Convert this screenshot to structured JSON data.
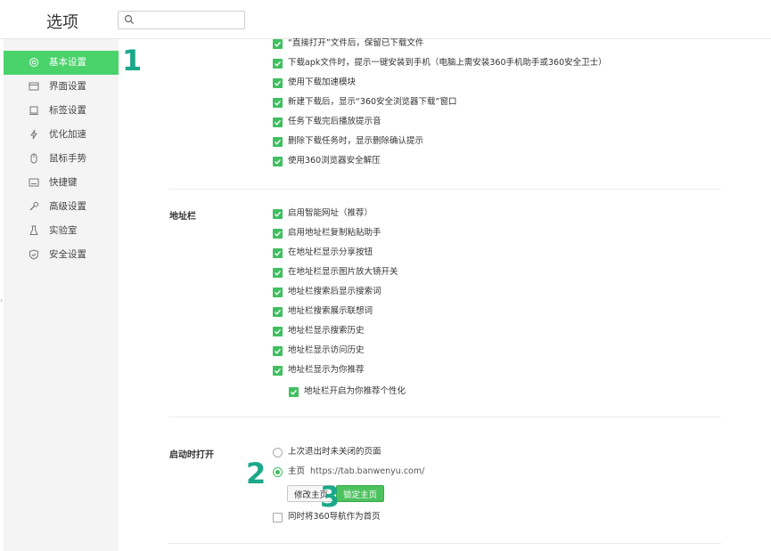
{
  "header": {
    "title": "选项",
    "search": {
      "value": "",
      "placeholder": ""
    }
  },
  "sidebar": {
    "items": [
      {
        "label": "基本设置",
        "icon": "gear-icon",
        "active": true
      },
      {
        "label": "界面设置",
        "icon": "window-icon",
        "active": false
      },
      {
        "label": "标签设置",
        "icon": "tab-icon",
        "active": false
      },
      {
        "label": "优化加速",
        "icon": "lightning-icon",
        "active": false
      },
      {
        "label": "鼠标手势",
        "icon": "mouse-icon",
        "active": false
      },
      {
        "label": "快捷键",
        "icon": "keyboard-icon",
        "active": false
      },
      {
        "label": "高级设置",
        "icon": "wrench-icon",
        "active": false
      },
      {
        "label": "实验室",
        "icon": "flask-icon",
        "active": false
      },
      {
        "label": "安全设置",
        "icon": "shield-icon",
        "active": false
      }
    ]
  },
  "download": {
    "options": [
      {
        "label": "“直接打开”文件后，保留已下载文件",
        "checked": true
      },
      {
        "label": "下载apk文件时，提示一键安装到手机（电脑上需安装360手机助手或360安全卫士）",
        "checked": true
      },
      {
        "label": "使用下载加速模块",
        "checked": true
      },
      {
        "label": "新建下载后，显示“360安全浏览器下载”窗口",
        "checked": true
      },
      {
        "label": "任务下载完后播放提示音",
        "checked": true
      },
      {
        "label": "删除下载任务时，显示删除确认提示",
        "checked": true
      },
      {
        "label": "使用360浏览器安全解压",
        "checked": true
      }
    ]
  },
  "address_bar": {
    "title": "地址栏",
    "options": [
      {
        "label": "启用智能网址（推荐）",
        "checked": true
      },
      {
        "label": "启用地址栏复制粘贴助手",
        "checked": true
      },
      {
        "label": "在地址栏显示分享按钮",
        "checked": true
      },
      {
        "label": "在地址栏显示图片放大镜开关",
        "checked": true
      },
      {
        "label": "地址栏搜索后显示搜索词",
        "checked": true
      },
      {
        "label": "地址栏搜索展示联想词",
        "checked": true
      },
      {
        "label": "地址栏显示搜索历史",
        "checked": true
      },
      {
        "label": "地址栏显示访问历史",
        "checked": true
      },
      {
        "label": "地址栏显示为你推荐",
        "checked": true
      }
    ],
    "sub_option": {
      "label": "地址栏开启为你推荐个性化",
      "checked": true
    }
  },
  "startup": {
    "title": "启动时打开",
    "radio_last_session": {
      "label": "上次退出时未关闭的页面",
      "selected": false
    },
    "radio_homepage": {
      "label": "主页",
      "url": "https://tab.banwenyu.com/",
      "selected": true
    },
    "modify_button": "修改主页",
    "lock_button": "锁定主页",
    "nav_home_option": {
      "label": "同时将360导航作为首页",
      "checked": false
    }
  },
  "annotations": {
    "marker_1": "1",
    "marker_2": "2",
    "marker_3": "3"
  },
  "colors": {
    "accent": "#4ad26b",
    "checkbox": "#3fbf5f",
    "marker": "#1ba88a"
  }
}
